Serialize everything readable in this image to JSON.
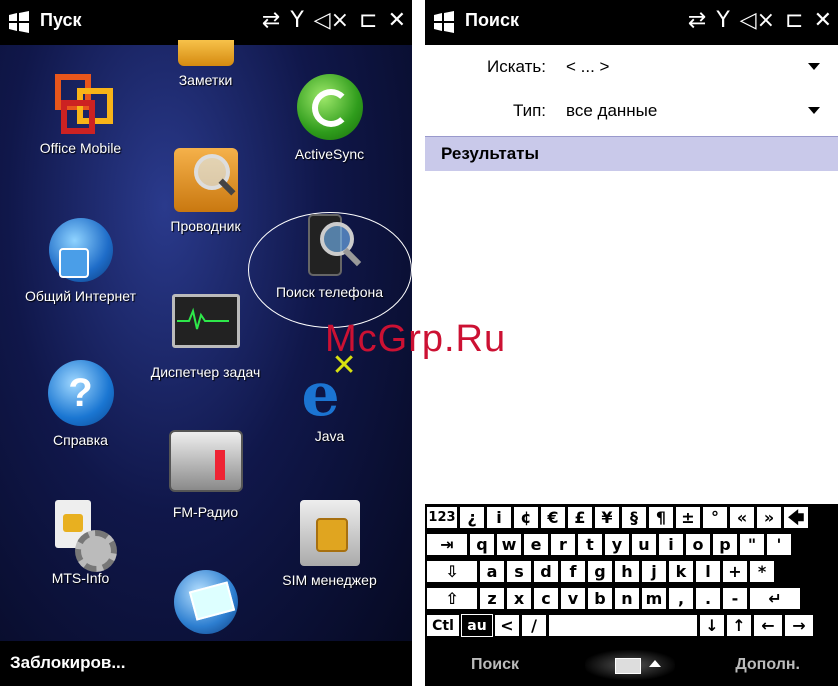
{
  "left": {
    "title": "Пуск",
    "status_icons": [
      "⇄",
      "Y",
      "◁×",
      "⊏",
      "✕"
    ],
    "apps": [
      {
        "label": "Заметки",
        "icon": "notes-icon"
      },
      {
        "label": "Office Mobile",
        "icon": "office-icon"
      },
      {
        "label": "ActiveSync",
        "icon": "activesync-icon"
      },
      {
        "label": "Проводник",
        "icon": "folder-search-icon"
      },
      {
        "label": "Общий Интернет",
        "icon": "globe-user-icon"
      },
      {
        "label": "Поиск телефона",
        "icon": "phone-search-icon"
      },
      {
        "label": "Диспетчер задач",
        "icon": "task-monitor-icon"
      },
      {
        "label": "Справка",
        "icon": "help-icon"
      },
      {
        "label": "Java",
        "icon": "java-icon"
      },
      {
        "label": "FM-Радио",
        "icon": "radio-icon"
      },
      {
        "label": "MTS-Info",
        "icon": "sim-gear-icon"
      },
      {
        "label": "SIM менеджер",
        "icon": "sim-card-icon"
      },
      {
        "label": "",
        "icon": "device-icon"
      }
    ],
    "bottom_label": "Заблокиров..."
  },
  "right": {
    "title": "Поиск",
    "search_label": "Искать:",
    "search_value": "< ... >",
    "type_label": "Тип:",
    "type_value": "все данные",
    "results_header": "Результаты",
    "keyboard": {
      "row1": [
        "123",
        "¿",
        "i",
        "¢",
        "€",
        "£",
        "¥",
        "§",
        "¶",
        "±",
        "°",
        "«",
        "»",
        "🡄"
      ],
      "row2": [
        "⇥",
        "q",
        "w",
        "e",
        "r",
        "t",
        "y",
        "u",
        "i",
        "o",
        "p",
        "\"",
        "'"
      ],
      "row3": [
        "⇩",
        "a",
        "s",
        "d",
        "f",
        "g",
        "h",
        "j",
        "k",
        "l",
        "+",
        "*"
      ],
      "row4": [
        "⇧",
        "z",
        "x",
        "c",
        "v",
        "b",
        "n",
        "m",
        ",",
        ".",
        "-",
        "↵"
      ],
      "row5": [
        "Ctl",
        "au",
        "<",
        "/",
        " ",
        "↓",
        "↑",
        "←",
        "→"
      ]
    },
    "softkey_left": "Поиск",
    "softkey_right": "Дополн."
  },
  "watermark": "McGrp.Ru"
}
